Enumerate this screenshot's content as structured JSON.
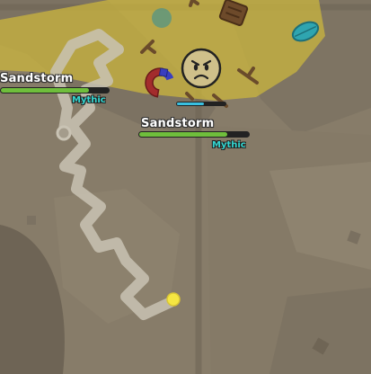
{
  "mobs": [
    {
      "name": "Sandstorm",
      "rarity": "Mythic",
      "health_fraction": 0.82
    },
    {
      "name": "Sandstorm",
      "rarity": "Mythic",
      "health_fraction": 0.8
    }
  ],
  "player": {
    "health_fraction": 0.55
  },
  "colors": {
    "ground": "#877c69",
    "zone_glow": "#cbb63e",
    "trail": "#c9c3b4",
    "health": "#6fbe3c",
    "mythic": "#33d6d0",
    "player_body": "#f0d34a",
    "player_health": "#39c0e0",
    "magnet_red": "#a32c2c",
    "magnet_blue": "#3a3ec0",
    "pellet": "#f5e642"
  },
  "icons": [
    "magnet-icon",
    "leaf-icon",
    "stick-icon",
    "grid-icon",
    "player-face-icon",
    "pellet-icon"
  ]
}
